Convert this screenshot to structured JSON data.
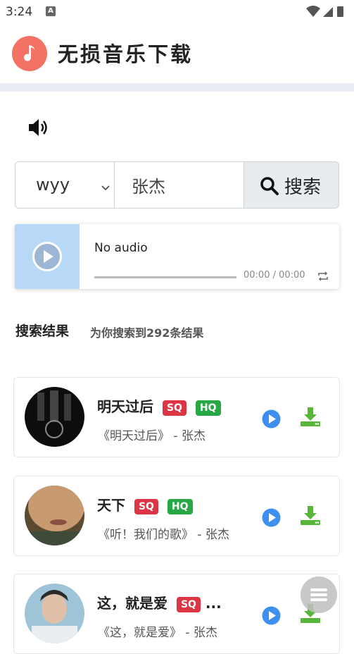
{
  "status_bar": {
    "time": "3:24",
    "notification_icon": "A"
  },
  "header": {
    "title": "无损音乐下载",
    "logo_icon": "music-note-icon",
    "accent_color": "#f47264"
  },
  "volume": {
    "icon": "volume-icon"
  },
  "search": {
    "source_value": "wyy",
    "query": "张杰",
    "button_label": "搜索"
  },
  "player": {
    "title": "No audio",
    "time": "00:00 / 00:00",
    "progress": 0
  },
  "results": {
    "title": "搜索结果",
    "count_text": "为你搜索到292条结果",
    "items": [
      {
        "title": "明天过后",
        "badges": [
          "SQ",
          "HQ"
        ],
        "meta": "《明天过后》 - 张杰"
      },
      {
        "title": "天下",
        "badges": [
          "SQ",
          "HQ"
        ],
        "meta": "《听！我们的歌》 - 张杰"
      },
      {
        "title": "这，就是爱",
        "badges": [
          "SQ"
        ],
        "ellipsis": "...",
        "meta": "《这，就是爱》 - 张杰"
      }
    ]
  },
  "colors": {
    "sq": "#dc3545",
    "hq": "#28a745",
    "play": "#3d8ff0",
    "download": "#57b63a"
  }
}
